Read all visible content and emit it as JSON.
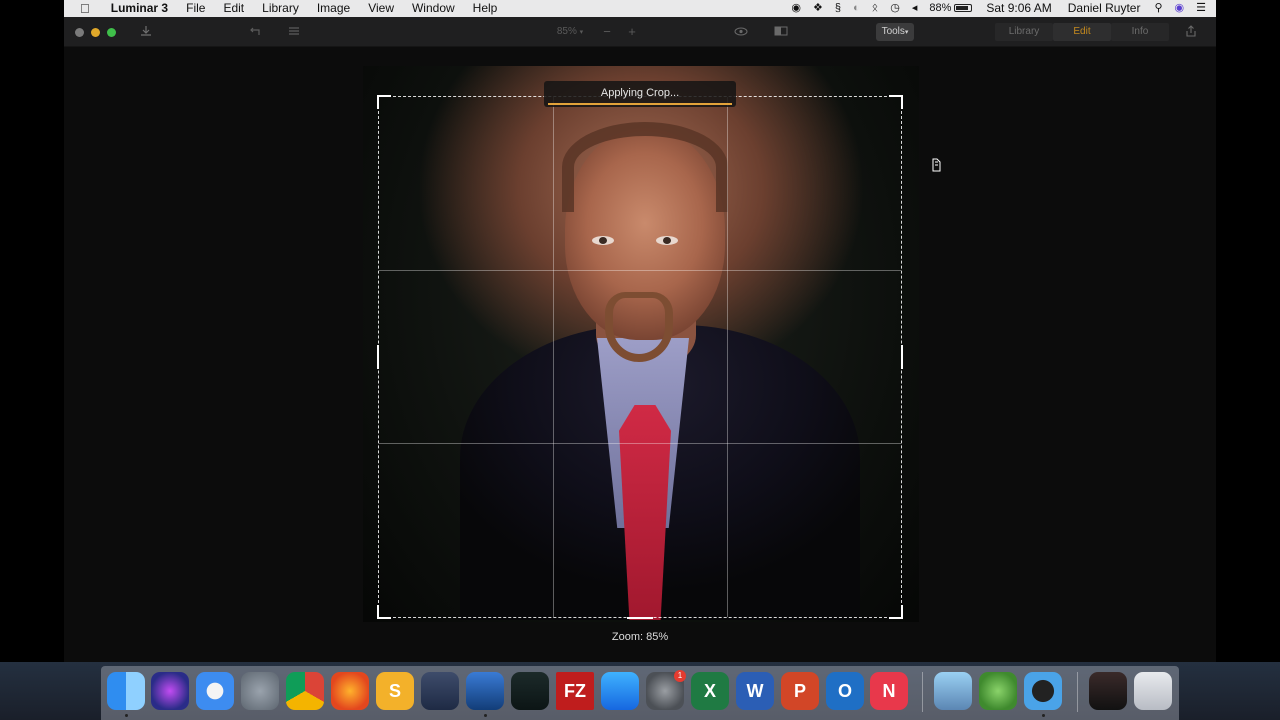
{
  "menubar": {
    "app_name": "Luminar 3",
    "menus": [
      "File",
      "Edit",
      "Library",
      "Image",
      "View",
      "Window",
      "Help"
    ],
    "battery": "88%",
    "clock": "Sat 9:06 AM",
    "user": "Daniel Ruyter"
  },
  "toolbar": {
    "zoom_value": "85%",
    "tools_label": "Tools",
    "tabs": [
      "Library",
      "Edit",
      "Info"
    ],
    "active_tab": "Edit",
    "accent_color": "#c58a1e"
  },
  "canvas": {
    "progress_label": "Applying Crop...",
    "progress_fraction": 1.0,
    "zoom_label": "Zoom: 85%"
  },
  "dock": {
    "apps": [
      {
        "icon": "finder-icon"
      },
      {
        "icon": "siri-icon"
      },
      {
        "icon": "safari-icon"
      },
      {
        "icon": "launchpad-icon"
      },
      {
        "icon": "chrome-icon"
      },
      {
        "icon": "firefox-icon"
      },
      {
        "icon": "slides-icon",
        "glyph": "S"
      },
      {
        "icon": "layers-icon"
      },
      {
        "icon": "luminar-icon"
      },
      {
        "icon": "filmora-icon"
      },
      {
        "icon": "filezilla-icon",
        "glyph": "FZ"
      },
      {
        "icon": "app-store-icon"
      },
      {
        "icon": "system-preferences-icon",
        "badge": "1"
      },
      {
        "icon": "excel-icon",
        "glyph": "X"
      },
      {
        "icon": "word-icon",
        "glyph": "W"
      },
      {
        "icon": "powerpoint-icon",
        "glyph": "P"
      },
      {
        "icon": "outlook-icon",
        "glyph": "O"
      },
      {
        "icon": "news-icon",
        "glyph": "N"
      },
      {
        "icon": "preview-icon"
      },
      {
        "icon": "green-app-icon"
      },
      {
        "icon": "quicktime-icon"
      },
      {
        "icon": "photo-thumbnail-icon"
      },
      {
        "icon": "trash-icon"
      }
    ]
  }
}
